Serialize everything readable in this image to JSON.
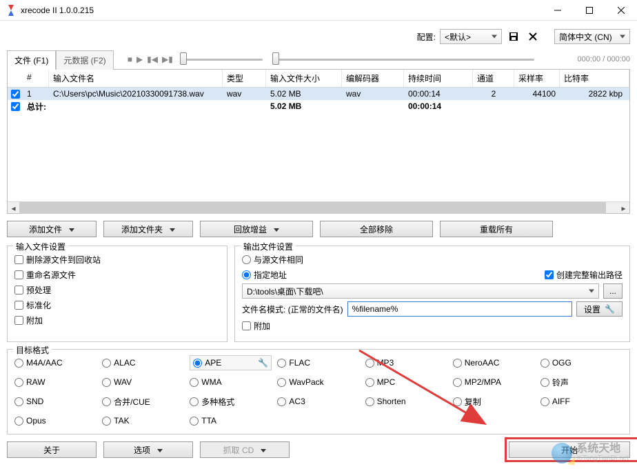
{
  "window": {
    "title": "xrecode II 1.0.0.215"
  },
  "config": {
    "label": "配置:",
    "selected": "<默认>",
    "language": "简体中文 (CN)"
  },
  "player": {
    "time": "000:00 / 000:00"
  },
  "tabs": {
    "files": "文件 (F1)",
    "metadata": "元数据 (F2)"
  },
  "grid": {
    "headers": {
      "idx": "#",
      "name": "输入文件名",
      "type": "类型",
      "size": "输入文件大小",
      "codec": "编解码器",
      "dur": "持续时间",
      "ch": "通道",
      "sr": "采样率",
      "br": "比特率"
    },
    "row": {
      "idx": "1",
      "name": "C:\\Users\\pc\\Music\\20210330091738.wav",
      "type": "wav",
      "size": "5.02 MB",
      "codec": "wav",
      "dur": "00:00:14",
      "ch": "2",
      "sr": "44100",
      "br": "2822 kbp"
    },
    "total": {
      "label": "总计:",
      "size": "5.02 MB",
      "dur": "00:00:14"
    }
  },
  "midbtns": {
    "add_file": "添加文件",
    "add_folder": "添加文件夹",
    "replaygain": "回放增益",
    "remove_all": "全部移除",
    "reload_all": "重载所有"
  },
  "input_settings": {
    "legend": "输入文件设置",
    "del_recycle": "删除源文件到回收站",
    "rename_src": "重命名源文件",
    "preprocess": "预处理",
    "normalize": "标准化",
    "append": "附加"
  },
  "output_settings": {
    "legend": "输出文件设置",
    "same_as_src": "与源文件相同",
    "specify": "指定地址",
    "create_full": "创建完整输出路径",
    "path_value": "D:\\tools\\桌面\\下载吧\\",
    "pattern_label": "文件名模式: (正常的文件名)",
    "pattern_value": "%filename%",
    "settings_btn": "设置",
    "append": "附加"
  },
  "formats": {
    "legend": "目标格式",
    "items": [
      [
        "M4A/AAC",
        "ALAC",
        "APE",
        "FLAC",
        "MP3",
        "NeroAAC",
        "OGG"
      ],
      [
        "RAW",
        "WAV",
        "WMA",
        "WavPack",
        "MPC",
        "MP2/MPA",
        "铃声"
      ],
      [
        "SND",
        "合并/CUE",
        "多种格式",
        "AC3",
        "Shorten",
        "复制",
        "AIFF"
      ],
      [
        "Opus",
        "TAK",
        "TTA",
        "",
        "",
        "",
        ""
      ]
    ],
    "selected": "APE"
  },
  "footer": {
    "about": "关于",
    "options": "选项",
    "grab_cd": "抓取 CD",
    "start": "开始"
  },
  "watermark": {
    "cn": "系统天地",
    "en": "XiTongTianDi.net"
  }
}
